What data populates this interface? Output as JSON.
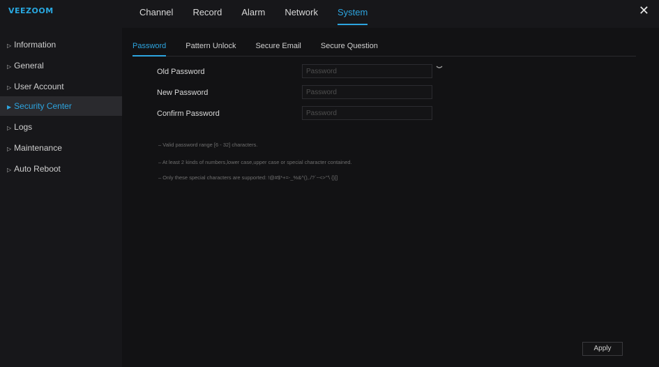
{
  "app": {
    "logo": "VEEZOOM"
  },
  "nav": {
    "tabs": [
      {
        "label": "Channel"
      },
      {
        "label": "Record"
      },
      {
        "label": "Alarm"
      },
      {
        "label": "Network"
      },
      {
        "label": "System"
      }
    ],
    "active": "System",
    "close_label": "✕"
  },
  "sidebar": {
    "items": [
      {
        "label": "Information"
      },
      {
        "label": "General"
      },
      {
        "label": "User Account"
      },
      {
        "label": "Security Center"
      },
      {
        "label": "Logs"
      },
      {
        "label": "Maintenance"
      },
      {
        "label": "Auto Reboot"
      }
    ],
    "active": "Security Center"
  },
  "subtabs": [
    {
      "label": "Password"
    },
    {
      "label": "Pattern Unlock"
    },
    {
      "label": "Secure Email"
    },
    {
      "label": "Secure Question"
    }
  ],
  "form": {
    "old_password": {
      "label": "Old Password",
      "placeholder": "Password"
    },
    "new_password": {
      "label": "New Password",
      "placeholder": "Password"
    },
    "confirm_password": {
      "label": "Confirm Password",
      "placeholder": "Password"
    }
  },
  "hints": [
    "– Valid password range [6 - 32] characters.",
    "– At least 2 kinds of numbers,lower case,upper case or special character contained.",
    "– Only these special characters are supported: !@#$*+=-_%&^(),./?`~<>'\"\\ {}[]"
  ],
  "apply_label": "Apply",
  "colors": {
    "accent": "#2da5e0",
    "background": "#121214",
    "sidebar": "#17171a"
  },
  "icons": {
    "eye": "eye-icon",
    "close": "close-icon",
    "arrow": "triangle-right-icon"
  }
}
